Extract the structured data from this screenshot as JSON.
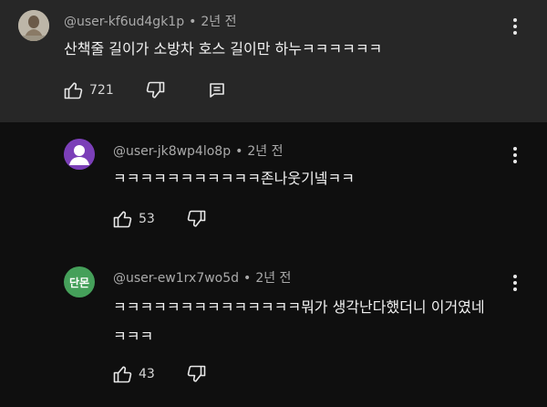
{
  "comments": [
    {
      "user": "@user-kf6ud4gk1p",
      "separator": "•",
      "time": "2년 전",
      "text": "산책줄 길이가 소방차 호스 길이만 하누ㅋㅋㅋㅋㅋㅋ",
      "likes": "721",
      "avatar_icon": "photo-avatar-icon"
    },
    {
      "user": "@user-jk8wp4lo8p",
      "separator": "•",
      "time": "2년 전",
      "text": "ㅋㅋㅋㅋㅋㅋㅋㅋㅋㅋㅋ존나웃기넼ㅋㅋ",
      "likes": "53",
      "avatar_icon": "default-person-avatar-icon"
    },
    {
      "user": "@user-ew1rx7wo5d",
      "separator": "•",
      "time": "2년 전",
      "text_line1": "ㅋㅋㅋㅋㅋㅋㅋㅋㅋㅋㅋㅋㅋㅋ뭐가 생각난다했더니 이거였네",
      "text_line2": "ㅋㅋㅋ",
      "likes": "43",
      "avatar_text": "단몬"
    }
  ],
  "colors": {
    "background": "#0f0f0f",
    "highlight_background": "#272727",
    "secondary_text": "#aaaaaa",
    "purple_avatar": "#7b3fb8",
    "green_avatar": "#45a05a"
  }
}
